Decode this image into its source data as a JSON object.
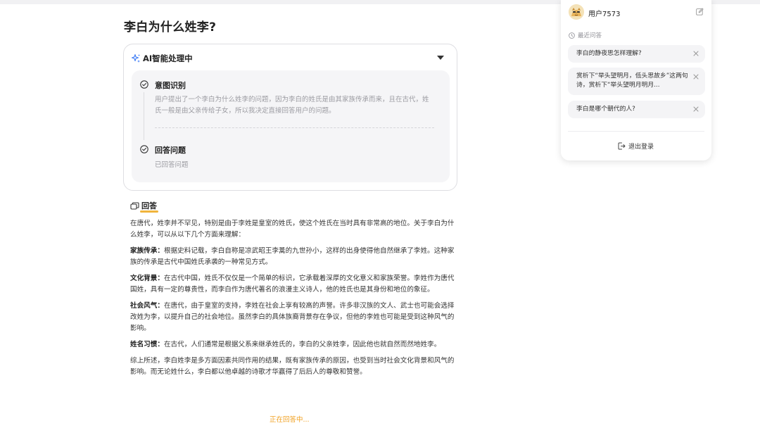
{
  "question": {
    "title": "李白为什么姓李?"
  },
  "process": {
    "title": "AI智能处理中",
    "steps": [
      {
        "title": "意图识别",
        "desc": "用户提出了一个李白为什么姓李的问题，因为李白的姓氏是由其家族传承而来，且在古代，姓氏一般是由父亲传给子女，所以我决定直接回答用户的问题。"
      },
      {
        "title": "回答问题",
        "desc": "已回答问题"
      }
    ]
  },
  "answer": {
    "heading": "回答",
    "intro": "在唐代，姓李并不罕见，特别是由于李姓是皇室的姓氏，使这个姓氏在当时具有非常高的地位。关于李白为什么姓李，可以从以下几个方面来理解：",
    "points": [
      {
        "label": "家族传承：",
        "text": "根据史料记载，李白自称是凉武昭王李暠的九世孙小，这样的出身使得他自然继承了李姓。这种家族的传承是古代中国姓氏承袭的一种常见方式。"
      },
      {
        "label": "文化背景：",
        "text": "在古代中国，姓氏不仅仅是一个简单的标识，它承载着深厚的文化意义和家族荣誉。李姓作为唐代国姓，具有一定的尊贵性，而李白作为唐代著名的浪漫主义诗人，他的姓氏也是其身份和地位的象征。"
      },
      {
        "label": "社会风气：",
        "text": "在唐代，由于皇室的支持，李姓在社会上享有较高的声誉。许多非汉族的文人、武士也可能会选择改姓为李，以提升自己的社会地位。虽然李白的具体族裔背景存在争议，但他的李姓也可能是受到这种风气的影响。"
      },
      {
        "label": "姓名习惯：",
        "text": "在古代，人们通常是根据父系来继承姓氏的，李白的父亲姓李，因此他也就自然而然地姓李。"
      }
    ],
    "conclusion": "综上所述，李白姓李是多方面因素共同作用的结果，既有家族传承的原因，也受到当时社会文化背景和风气的影响。而无论姓什么，李白都以他卓越的诗歌才华赢得了后后人的尊敬和赞誉。",
    "status": "正在回答中..."
  },
  "user_panel": {
    "username": "用户7573",
    "recent_label": "最近问答",
    "recent_items": [
      "李白的静夜思怎样理解?",
      "赏析下“举头望明月，低头思故乡”这两句诗，赏析下“举头望明月明月...",
      "李白是哪个朝代的人?"
    ],
    "logout_label": "退出登录"
  },
  "colors": {
    "accent": "#f0b43c",
    "status": "#f0a020",
    "ai_icon": "#3c7bf5"
  },
  "icons": [
    "sparkle-icon",
    "chevron-down-icon",
    "check-circle-icon",
    "answer-bubble-icon",
    "avatar",
    "edit-icon",
    "clock-icon",
    "close-icon",
    "logout-icon"
  ]
}
